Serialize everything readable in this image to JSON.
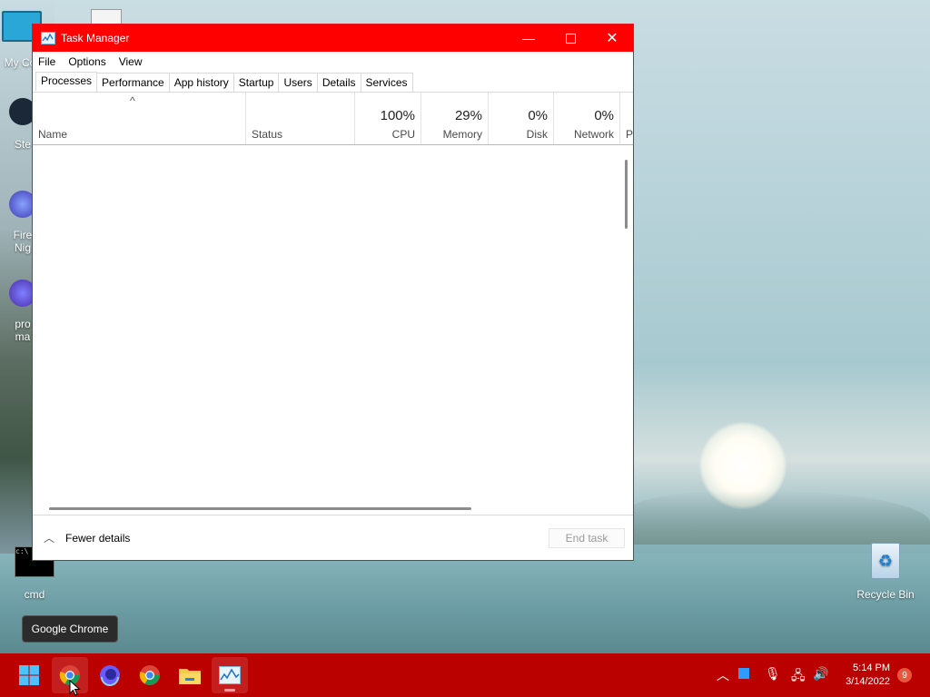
{
  "desktop": {
    "icons": [
      {
        "label": "My Co",
        "icon": "computer-icon"
      },
      {
        "label": "Ste",
        "icon": "steam-icon"
      },
      {
        "label": "Fire Nig",
        "icon": "firefox-nightly-icon"
      },
      {
        "label": "pro ma",
        "icon": "firefox-icon"
      },
      {
        "label": "cmd",
        "icon": "cmd-icon"
      },
      {
        "label": "Recycle Bin",
        "icon": "recycle-bin-icon"
      }
    ]
  },
  "window": {
    "title": "Task Manager",
    "title_bar_color": "#ff0000",
    "menu": [
      "File",
      "Options",
      "View"
    ],
    "tabs": [
      "Processes",
      "Performance",
      "App history",
      "Startup",
      "Users",
      "Details",
      "Services"
    ],
    "active_tab": "Processes",
    "columns": {
      "name": "Name",
      "status": "Status",
      "cpu": {
        "pct": "100%",
        "label": "CPU"
      },
      "memory": {
        "pct": "29%",
        "label": "Memory"
      },
      "disk": {
        "pct": "0%",
        "label": "Disk"
      },
      "network": {
        "pct": "0%",
        "label": "Network"
      },
      "power": "P"
    },
    "footer": {
      "fewer_details": "Fewer details",
      "end_task": "End task"
    }
  },
  "tooltip": "Google Chrome",
  "taskbar": {
    "color": "#bb0000",
    "apps": [
      "start-icon",
      "chrome-icon",
      "firefox-nightly-icon",
      "chrome-icon",
      "file-explorer-icon",
      "task-manager-icon"
    ],
    "clock_time": "5:14 PM",
    "clock_date": "3/14/2022",
    "notifications": "9"
  }
}
